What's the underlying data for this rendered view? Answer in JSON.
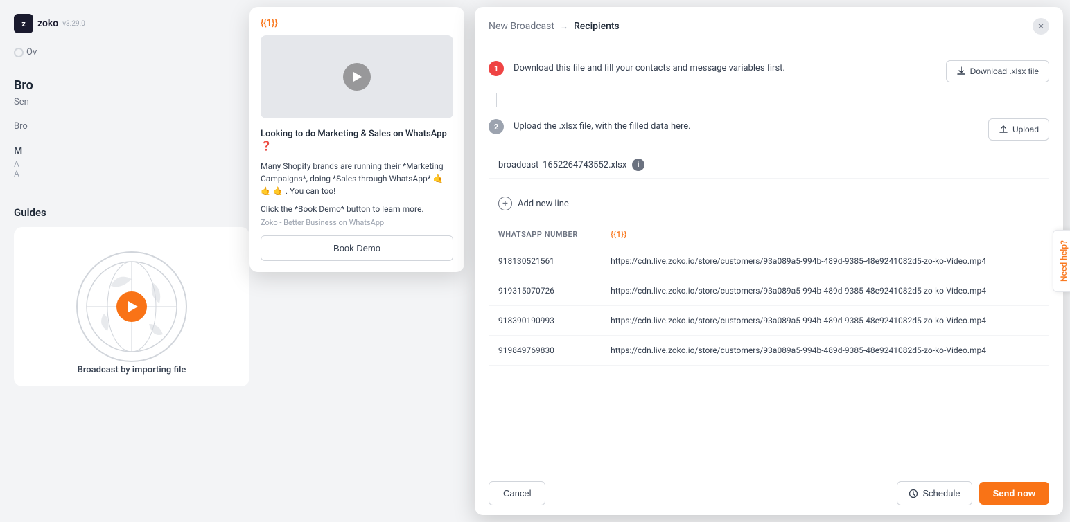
{
  "app": {
    "name": "zoko",
    "version": "v3.29.0"
  },
  "background": {
    "radio_label": "Ov",
    "section_title": "Bro",
    "section_sub_1": "Sen",
    "section_sub_2": "Bro",
    "middle_title": "M",
    "middle_sub": "A",
    "middle_sub2": "A",
    "guides_title": "Guides",
    "guides_card_label": "Broadcast by importing file"
  },
  "promo_card": {
    "tag": "{{1}}",
    "headline": "Looking to do Marketing & Sales on WhatsApp ❓",
    "body": "Many Shopify brands are running their *Marketing Campaigns*, doing *Sales through WhatsApp* 🤙 🤙 🤙 . You can too!",
    "cta_text": "Click the *Book Demo* button to learn more.",
    "source": "Zoko - Better Business on WhatsApp",
    "btn_label": "Book Demo"
  },
  "modal": {
    "breadcrumb_link": "New Broadcast",
    "breadcrumb_arrow": "→",
    "breadcrumb_current": "Recipients",
    "step1": {
      "number": "1",
      "text": "Download this file and fill your contacts and message variables first.",
      "btn_label": "Download .xlsx file"
    },
    "step2": {
      "number": "2",
      "text": "Upload the .xlsx file, with the filled data here.",
      "btn_label": "Upload"
    },
    "filename": "broadcast_1652264743552.xlsx",
    "info_icon": "i",
    "table": {
      "columns": [
        {
          "id": "whatsapp_number",
          "label": "WHATSAPP NUMBER"
        },
        {
          "id": "var1",
          "label": "{{1}}"
        }
      ],
      "rows": [
        {
          "phone": "918130521561",
          "value": "https://cdn.live.zoko.io/store/customers/93a089a5-994b-489d-9385-48e9241082d5-zo-ko-Video.mp4"
        },
        {
          "phone": "919315070726",
          "value": "https://cdn.live.zoko.io/store/customers/93a089a5-994b-489d-9385-48e9241082d5-zo-ko-Video.mp4"
        },
        {
          "phone": "918390190993",
          "value": "https://cdn.live.zoko.io/store/customers/93a089a5-994b-489d-9385-48e9241082d5-zo-ko-Video.mp4"
        },
        {
          "phone": "919849769830",
          "value": "https://cdn.live.zoko.io/store/customers/93a089a5-994b-489d-9385-48e9241082d5-zo-ko-Video.mp4"
        }
      ]
    },
    "add_line_label": "Add new line",
    "footer": {
      "cancel_label": "Cancel",
      "schedule_label": "Schedule",
      "send_now_label": "Send now"
    }
  },
  "need_help": {
    "label": "Need help?"
  }
}
